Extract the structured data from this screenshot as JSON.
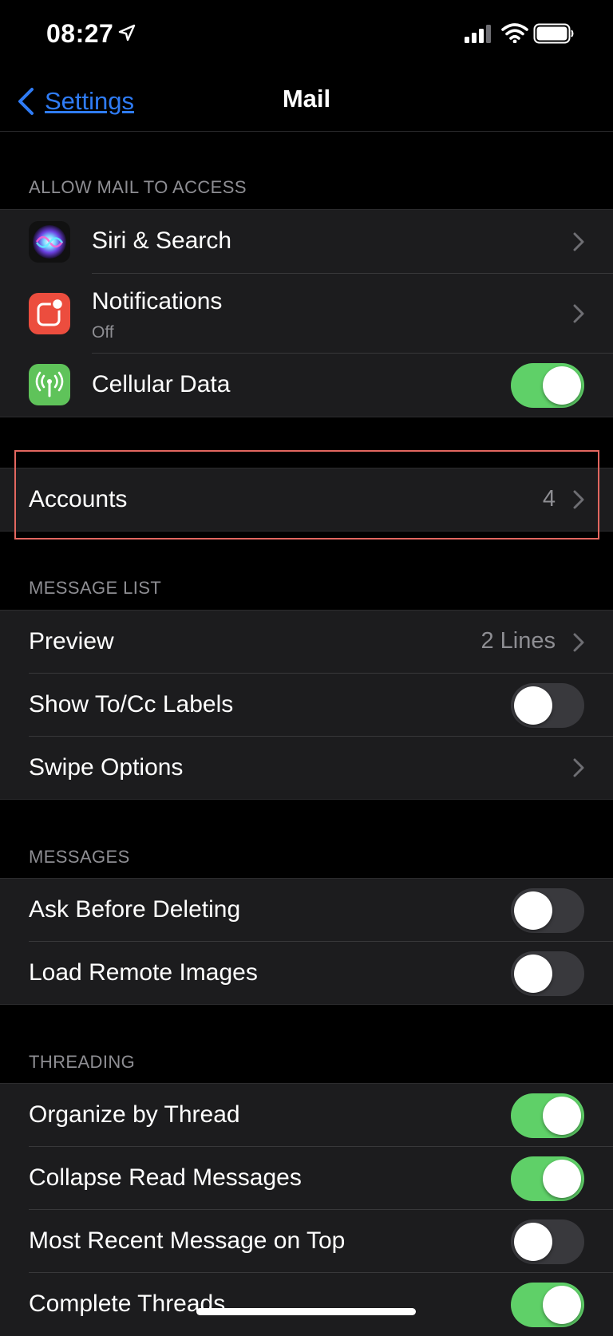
{
  "status_bar": {
    "time": "08:27"
  },
  "nav": {
    "back_label": "Settings",
    "title": "Mail"
  },
  "sections": {
    "allow_access": {
      "header": "ALLOW MAIL TO ACCESS",
      "siri": {
        "label": "Siri & Search",
        "icon": "siri-icon"
      },
      "notifications": {
        "label": "Notifications",
        "sublabel": "Off",
        "icon": "notifications-icon"
      },
      "cellular": {
        "label": "Cellular Data",
        "icon": "cellular-antenna-icon",
        "enabled": true
      }
    },
    "accounts": {
      "label": "Accounts",
      "value": "4"
    },
    "message_list": {
      "header": "MESSAGE LIST",
      "preview": {
        "label": "Preview",
        "value": "2 Lines"
      },
      "show_to_cc": {
        "label": "Show To/Cc Labels",
        "enabled": false
      },
      "swipe_options": {
        "label": "Swipe Options"
      }
    },
    "messages": {
      "header": "MESSAGES",
      "ask_before_deleting": {
        "label": "Ask Before Deleting",
        "enabled": false
      },
      "load_remote_images": {
        "label": "Load Remote Images",
        "enabled": false
      }
    },
    "threading": {
      "header": "THREADING",
      "organize_by_thread": {
        "label": "Organize by Thread",
        "enabled": true
      },
      "collapse_read": {
        "label": "Collapse Read Messages",
        "enabled": true
      },
      "most_recent_on_top": {
        "label": "Most Recent Message on Top",
        "enabled": false
      },
      "complete_threads": {
        "label": "Complete Threads",
        "enabled": true
      }
    }
  },
  "colors": {
    "accent": "#2f7cf6",
    "toggle_on": "#5fd068",
    "toggle_off": "#39393d",
    "highlight": "#e2665f",
    "cell_bg": "#1c1c1e"
  }
}
